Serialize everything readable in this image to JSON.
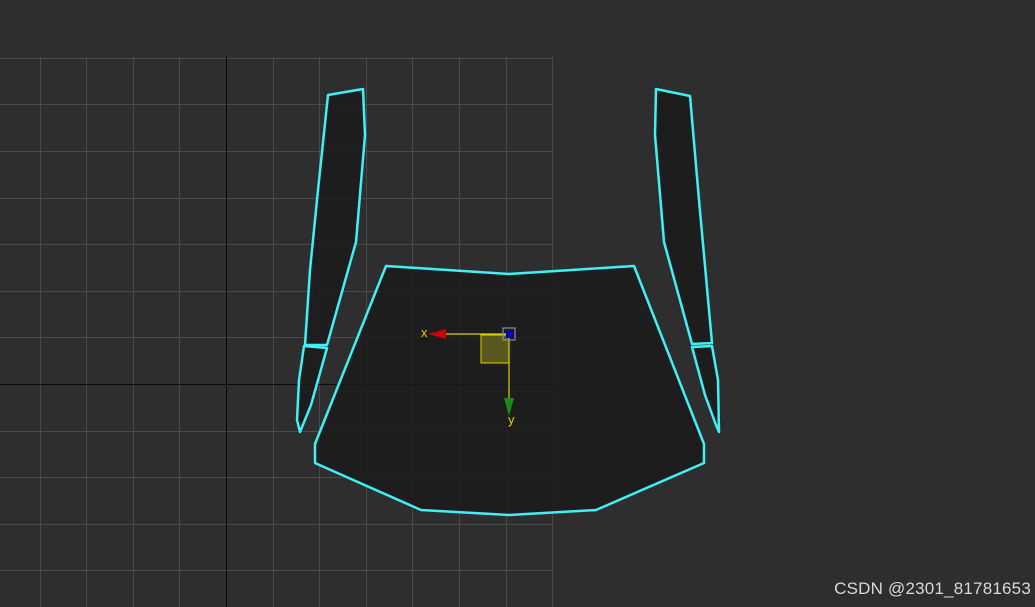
{
  "colors": {
    "background": "#2e2e2e",
    "grid_line": "#4a4a4a",
    "grid_axis": "#0a0a0a",
    "uv_edge": "#3ff0f5",
    "uv_fill": "#1a1a1a",
    "gizmo_x": "#cc0000",
    "gizmo_y": "#1a8a1a",
    "gizmo_z": "#0000cc",
    "gizmo_line": "#e0d000",
    "gizmo_plane": "#8a8a20",
    "watermark": "#d9d9d9"
  },
  "gizmo": {
    "x_label": "x",
    "y_label": "y"
  },
  "watermark": {
    "text": "CSDN @2301_81781653"
  }
}
